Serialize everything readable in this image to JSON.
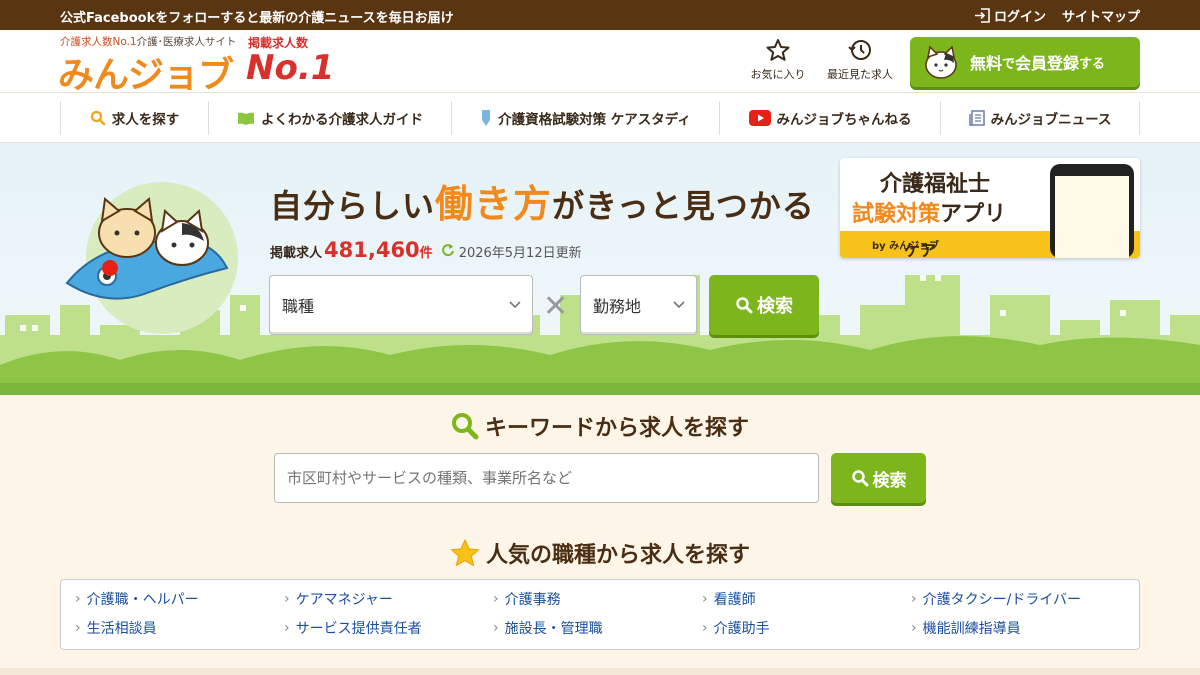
{
  "topbar": {
    "notice": "公式Facebookをフォローすると最新の介護ニュースを毎日お届け",
    "login": "ログイン",
    "sitemap": "サイトマップ"
  },
  "header": {
    "tagline_red": "介護求人数No.1",
    "tagline_gray": "介護･医療求人サイト",
    "logo": "みんジョブ",
    "no1_label": "掲載求人数",
    "no1": "No.1",
    "favorites": "お気に入り",
    "recent": "最近見た求人",
    "register_free": "無料",
    "register_de": "で",
    "register_main": "会員登録",
    "register_suru": "する"
  },
  "nav": [
    {
      "label": "求人を探す",
      "icon": "search-icon"
    },
    {
      "label": "よくわかる介護求人ガイド",
      "icon": "book-icon"
    },
    {
      "label": "介護資格試験対策 ケアスタディ",
      "icon": "pin-icon"
    },
    {
      "label": "みんジョブちゃんねる",
      "icon": "youtube-icon"
    },
    {
      "label": "みんジョブニュース",
      "icon": "news-icon"
    }
  ],
  "hero": {
    "headline_pre": "自分らしい",
    "headline_hl": "働き方",
    "headline_post": "がきっと見つかる",
    "jobs_label": "掲載求人",
    "jobs_count": "481,460",
    "jobs_unit": "件",
    "updated": "2026年5月12日更新",
    "job_select": "職種",
    "location_select": "勤務地",
    "search_button": "検索"
  },
  "app_banner": {
    "line1": "介護福祉士",
    "line2_orange": "試験対策",
    "line2_dark": "アプリ",
    "band": "ケアスタディ",
    "band_small": "by みんジョブ"
  },
  "keyword": {
    "title": "キーワードから求人を探す",
    "placeholder": "市区町村やサービスの種類、事業所名など",
    "button": "検索"
  },
  "popular": {
    "title": "人気の職種から求人を探す",
    "items": [
      "介護職・ヘルパー",
      "ケアマネジャー",
      "介護事務",
      "看護師",
      "介護タクシー/ドライバー",
      "生活相談員",
      "サービス提供責任者",
      "施設長・管理職",
      "介護助手",
      "機能訓練指導員"
    ]
  },
  "colors": {
    "brand_brown": "#5a3512",
    "accent_orange": "#f08a1c",
    "button_green": "#7db61c",
    "count_red": "#d9302c",
    "link_blue": "#1a4fa0"
  }
}
